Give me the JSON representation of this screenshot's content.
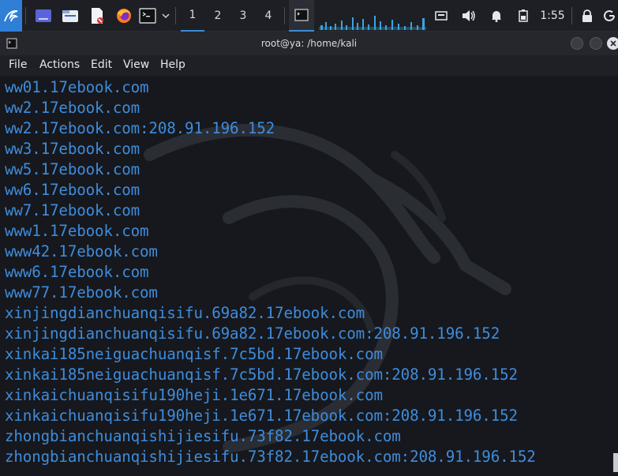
{
  "taskbar": {
    "launchers": [
      "kali-menu-icon",
      "workspace-preview-icon",
      "file-manager-icon",
      "text-editor-icon",
      "firefox-icon",
      "terminal-icon"
    ],
    "workspaces": [
      "1",
      "2",
      "3",
      "4"
    ],
    "active_workspace": "1",
    "clock": "1:55",
    "colors": {
      "accent": "#3d8bd9",
      "graph": "#3ba3e0"
    }
  },
  "window": {
    "title": "root@ya: /home/kali"
  },
  "menubar": {
    "items": [
      "File",
      "Actions",
      "Edit",
      "View",
      "Help"
    ]
  },
  "terminal": {
    "text_color": "#3f8cdc",
    "lines": [
      "ww01.17ebook.com",
      "ww2.17ebook.com",
      "ww2.17ebook.com:208.91.196.152",
      "ww3.17ebook.com",
      "ww5.17ebook.com",
      "ww6.17ebook.com",
      "ww7.17ebook.com",
      "www1.17ebook.com",
      "www42.17ebook.com",
      "www6.17ebook.com",
      "www77.17ebook.com",
      "xinjingdianchuanqisifu.69a82.17ebook.com",
      "xinjingdianchuanqisifu.69a82.17ebook.com:208.91.196.152",
      "xinkai185neiguachuanqisf.7c5bd.17ebook.com",
      "xinkai185neiguachuanqisf.7c5bd.17ebook.com:208.91.196.152",
      "xinkaichuanqisifu190heji.1e671.17ebook.com",
      "xinkaichuanqisifu190heji.1e671.17ebook.com:208.91.196.152",
      "zhongbianchuanqishijiesifu.73f82.17ebook.com",
      "zhongbianchuanqishijiesifu.73f82.17ebook.com:208.91.196.152"
    ]
  }
}
